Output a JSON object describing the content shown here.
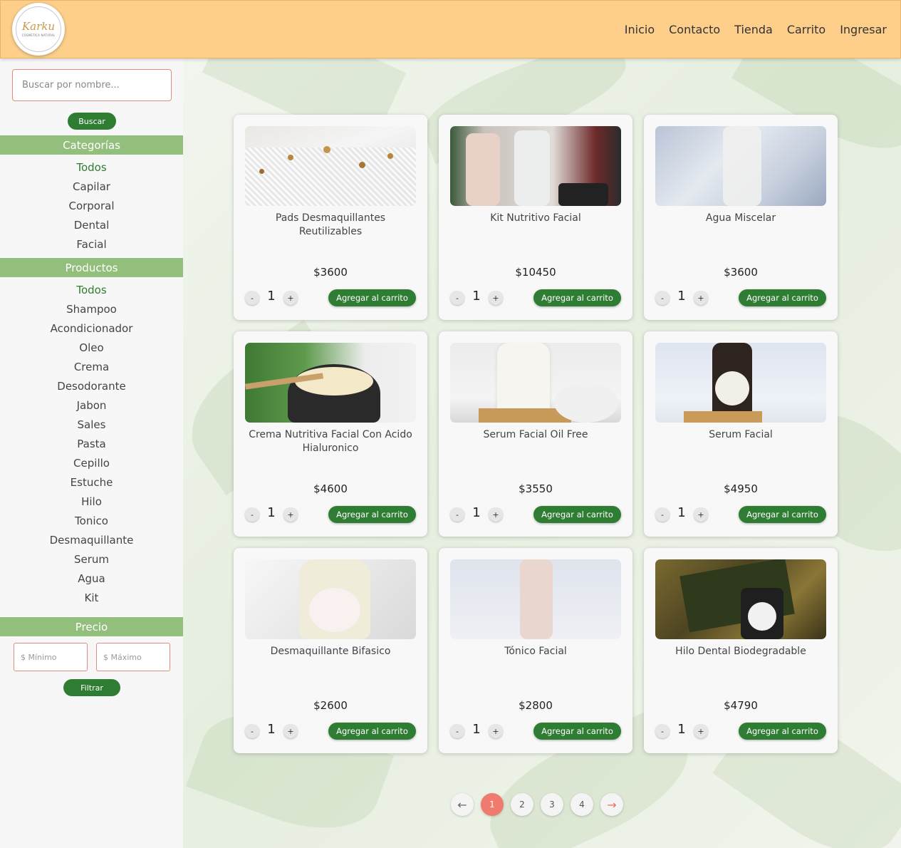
{
  "header": {
    "logo_text": "Karku",
    "logo_subtext": "COSMETICA NATURAL",
    "nav": [
      "Inicio",
      "Contacto",
      "Tienda",
      "Carrito",
      "Ingresar"
    ]
  },
  "sidebar": {
    "search_placeholder": "Buscar por nombre...",
    "search_button": "Buscar",
    "categories_heading": "Categorías",
    "categories": [
      "Todos",
      "Capilar",
      "Corporal",
      "Dental",
      "Facial"
    ],
    "products_heading": "Productos",
    "products": [
      "Todos",
      "Shampoo",
      "Acondicionador",
      "Oleo",
      "Crema",
      "Desodorante",
      "Jabon",
      "Sales",
      "Pasta",
      "Cepillo",
      "Estuche",
      "Hilo",
      "Tonico",
      "Desmaquillante",
      "Serum",
      "Agua",
      "Kit"
    ],
    "price_heading": "Precio",
    "min_placeholder": "$ Mínimo",
    "max_placeholder": "$ Máximo",
    "filter_button": "Filtrar"
  },
  "products": [
    {
      "title": "Pads Desmaquillantes Reutilizables",
      "price": "$3600",
      "qty": "1",
      "add_label": "Agregar al carrito"
    },
    {
      "title": "Kit Nutritivo Facial",
      "price": "$10450",
      "qty": "1",
      "add_label": "Agregar al carrito"
    },
    {
      "title": "Agua Miscelar",
      "price": "$3600",
      "qty": "1",
      "add_label": "Agregar al carrito"
    },
    {
      "title": "Crema Nutritiva Facial Con Acido Hialuronico",
      "price": "$4600",
      "qty": "1",
      "add_label": "Agregar al carrito"
    },
    {
      "title": "Serum Facial Oil Free",
      "price": "$3550",
      "qty": "1",
      "add_label": "Agregar al carrito"
    },
    {
      "title": "Serum Facial",
      "price": "$4950",
      "qty": "1",
      "add_label": "Agregar al carrito"
    },
    {
      "title": "Desmaquillante Bifasico",
      "price": "$2600",
      "qty": "1",
      "add_label": "Agregar al carrito"
    },
    {
      "title": "Tónico Facial",
      "price": "$2800",
      "qty": "1",
      "add_label": "Agregar al carrito"
    },
    {
      "title": "Hilo Dental Biodegradable",
      "price": "$4790",
      "qty": "1",
      "add_label": "Agregar al carrito"
    }
  ],
  "qty_minus": "-",
  "qty_plus": "+",
  "pagination": {
    "prev": "←",
    "pages": [
      "1",
      "2",
      "3",
      "4"
    ],
    "next": "→",
    "current": "1"
  }
}
